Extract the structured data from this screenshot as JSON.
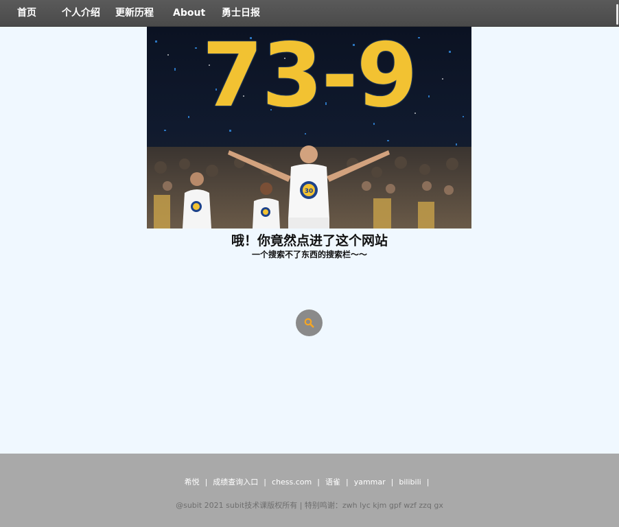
{
  "nav": {
    "items": [
      {
        "label": "首页"
      },
      {
        "label": "个人介绍"
      },
      {
        "label": "更新历程"
      },
      {
        "label": "About"
      },
      {
        "label": "勇士日报"
      }
    ]
  },
  "hero": {
    "score_text": "73-9",
    "jersey_number": "30"
  },
  "headline": "哦！你竟然点进了这个网站",
  "subheadline": "一个搜索不了东西的搜索栏～～",
  "search": {
    "icon": "search-icon",
    "icon_color": "#f5a623"
  },
  "footer": {
    "links": [
      {
        "label": "希悦"
      },
      {
        "label": "成绩查询入口"
      },
      {
        "label": "chess.com"
      },
      {
        "label": "语雀"
      },
      {
        "label": "yammar"
      },
      {
        "label": "bilibili"
      }
    ],
    "separator": "|",
    "copyright": "@subit 2021 subit技术课版权所有 | 特别鸣谢：zwh lyc kjm gpf wzf zzq gx"
  },
  "colors": {
    "nav_bg": "#4f4f4f",
    "page_bg": "#f0f8ff",
    "footer_bg": "#a9a9a9",
    "score_yellow": "#f2c232",
    "warriors_blue": "#1d428a"
  }
}
